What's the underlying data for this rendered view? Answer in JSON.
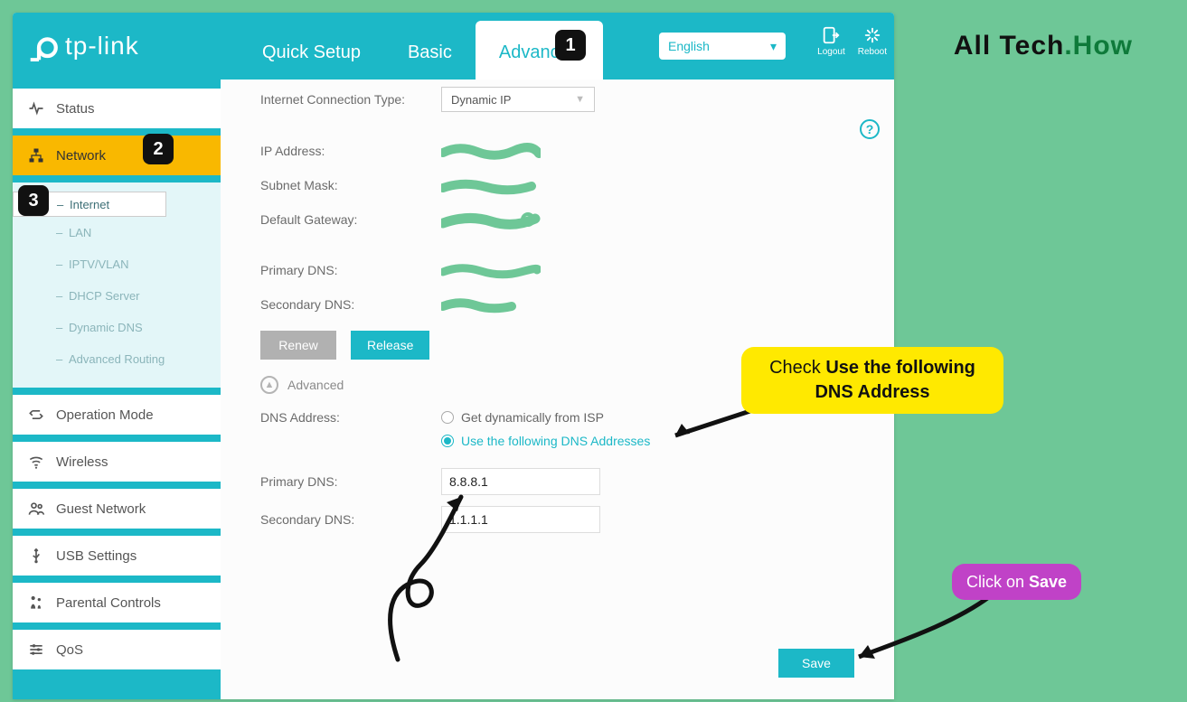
{
  "watermark": {
    "pre": "All Tech",
    "dot": ".",
    "post": "How"
  },
  "brand": "tp-link",
  "topnav": {
    "quick": "Quick Setup",
    "basic": "Basic",
    "advanced": "Advanced"
  },
  "language": "English",
  "topactions": {
    "logout": "Logout",
    "reboot": "Reboot"
  },
  "sidebar": {
    "status": "Status",
    "network": "Network",
    "sub": {
      "internet": "Internet",
      "lan": "LAN",
      "iptv": "IPTV/VLAN",
      "dhcp": "DHCP Server",
      "ddns": "Dynamic DNS",
      "routing": "Advanced Routing"
    },
    "opmode": "Operation Mode",
    "wireless": "Wireless",
    "guest": "Guest Network",
    "usb": "USB Settings",
    "parental": "Parental Controls",
    "qos": "QoS"
  },
  "form": {
    "conn_type_lbl": "Internet Connection Type:",
    "conn_type_val": "Dynamic IP",
    "ip_lbl": "IP Address:",
    "mask_lbl": "Subnet Mask:",
    "gw_lbl": "Default Gateway:",
    "pdns_lbl": "Primary DNS:",
    "sdns_lbl": "Secondary DNS:",
    "renew": "Renew",
    "release": "Release",
    "advanced": "Advanced",
    "dnsaddr_lbl": "DNS Address:",
    "radio_isp": "Get dynamically from ISP",
    "radio_manual": "Use the following DNS Addresses",
    "pdns2_lbl": "Primary DNS:",
    "sdns2_lbl": "Secondary DNS:",
    "pdns_val": "8.8.8.1",
    "sdns_val": "1.1.1.1",
    "save": "Save"
  },
  "callouts": {
    "c1": "1",
    "c2": "2",
    "c3": "3"
  },
  "bubbles": {
    "dns_pre": "Check ",
    "dns_bold": "Use the following DNS Address",
    "save_pre": "Click on ",
    "save_bold": "Save"
  }
}
